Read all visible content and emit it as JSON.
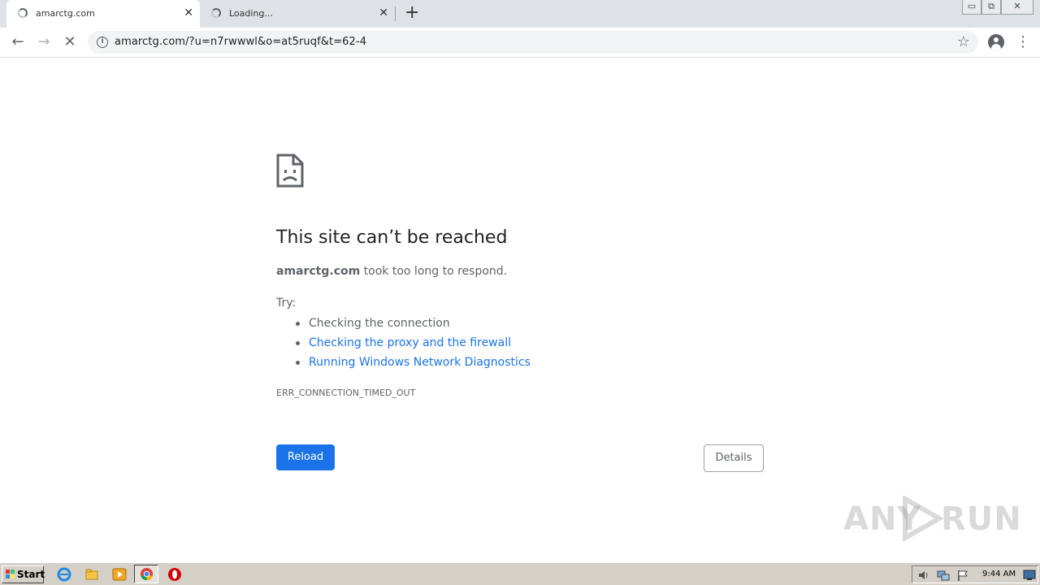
{
  "tabs": [
    {
      "title": "amarctg.com",
      "close": "✕"
    },
    {
      "title": "Loading...",
      "close": "✕"
    }
  ],
  "new_tab": "+",
  "window_controls": {
    "minimize": "▭",
    "restore": "⧉",
    "close": "✕"
  },
  "toolbar": {
    "back": "←",
    "forward": "→",
    "stop": "✕",
    "url": "amarctg.com/?u=n7rwwwl&o=at5ruqf&t=62-4",
    "bookmark": "☆",
    "menu": "⋮"
  },
  "error": {
    "title": "This site can’t be reached",
    "host": "amarctg.com",
    "description_suffix": " took too long to respond.",
    "try_label": "Try:",
    "suggestions": [
      {
        "text": "Checking the connection",
        "link": false
      },
      {
        "text": "Checking the proxy and the firewall",
        "link": true
      },
      {
        "text": "Running Windows Network Diagnostics",
        "link": true
      }
    ],
    "code": "ERR_CONNECTION_TIMED_OUT",
    "reload_label": "Reload",
    "details_label": "Details"
  },
  "watermark": "ANY RUN",
  "taskbar": {
    "start_label": "Start",
    "clock": "9:44 AM"
  },
  "colors": {
    "link": "#1a73e8",
    "button": "#1a73e8",
    "tabstrip": "#dee1e6",
    "taskbar": "#d4d0c8"
  }
}
